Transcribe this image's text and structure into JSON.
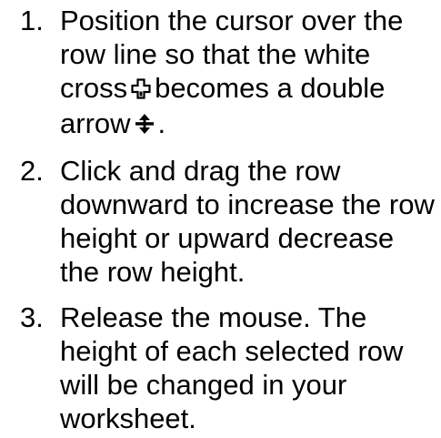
{
  "steps": [
    {
      "number": "1.",
      "lines": [
        "Position the cursor over the",
        "row line so that the white",
        "cross",
        "becomes a double",
        "arrow",
        "."
      ],
      "icons": [
        "white-cross-cursor-icon",
        "double-arrow-cursor-icon"
      ]
    },
    {
      "number": "2.",
      "lines": [
        "Click and drag the row",
        "downward to increase the row",
        "height or upward decrease",
        "the row height."
      ]
    },
    {
      "number": "3.",
      "lines": [
        "Release the mouse. The",
        "height of each selected row",
        "will be changed in your",
        "worksheet."
      ]
    }
  ]
}
